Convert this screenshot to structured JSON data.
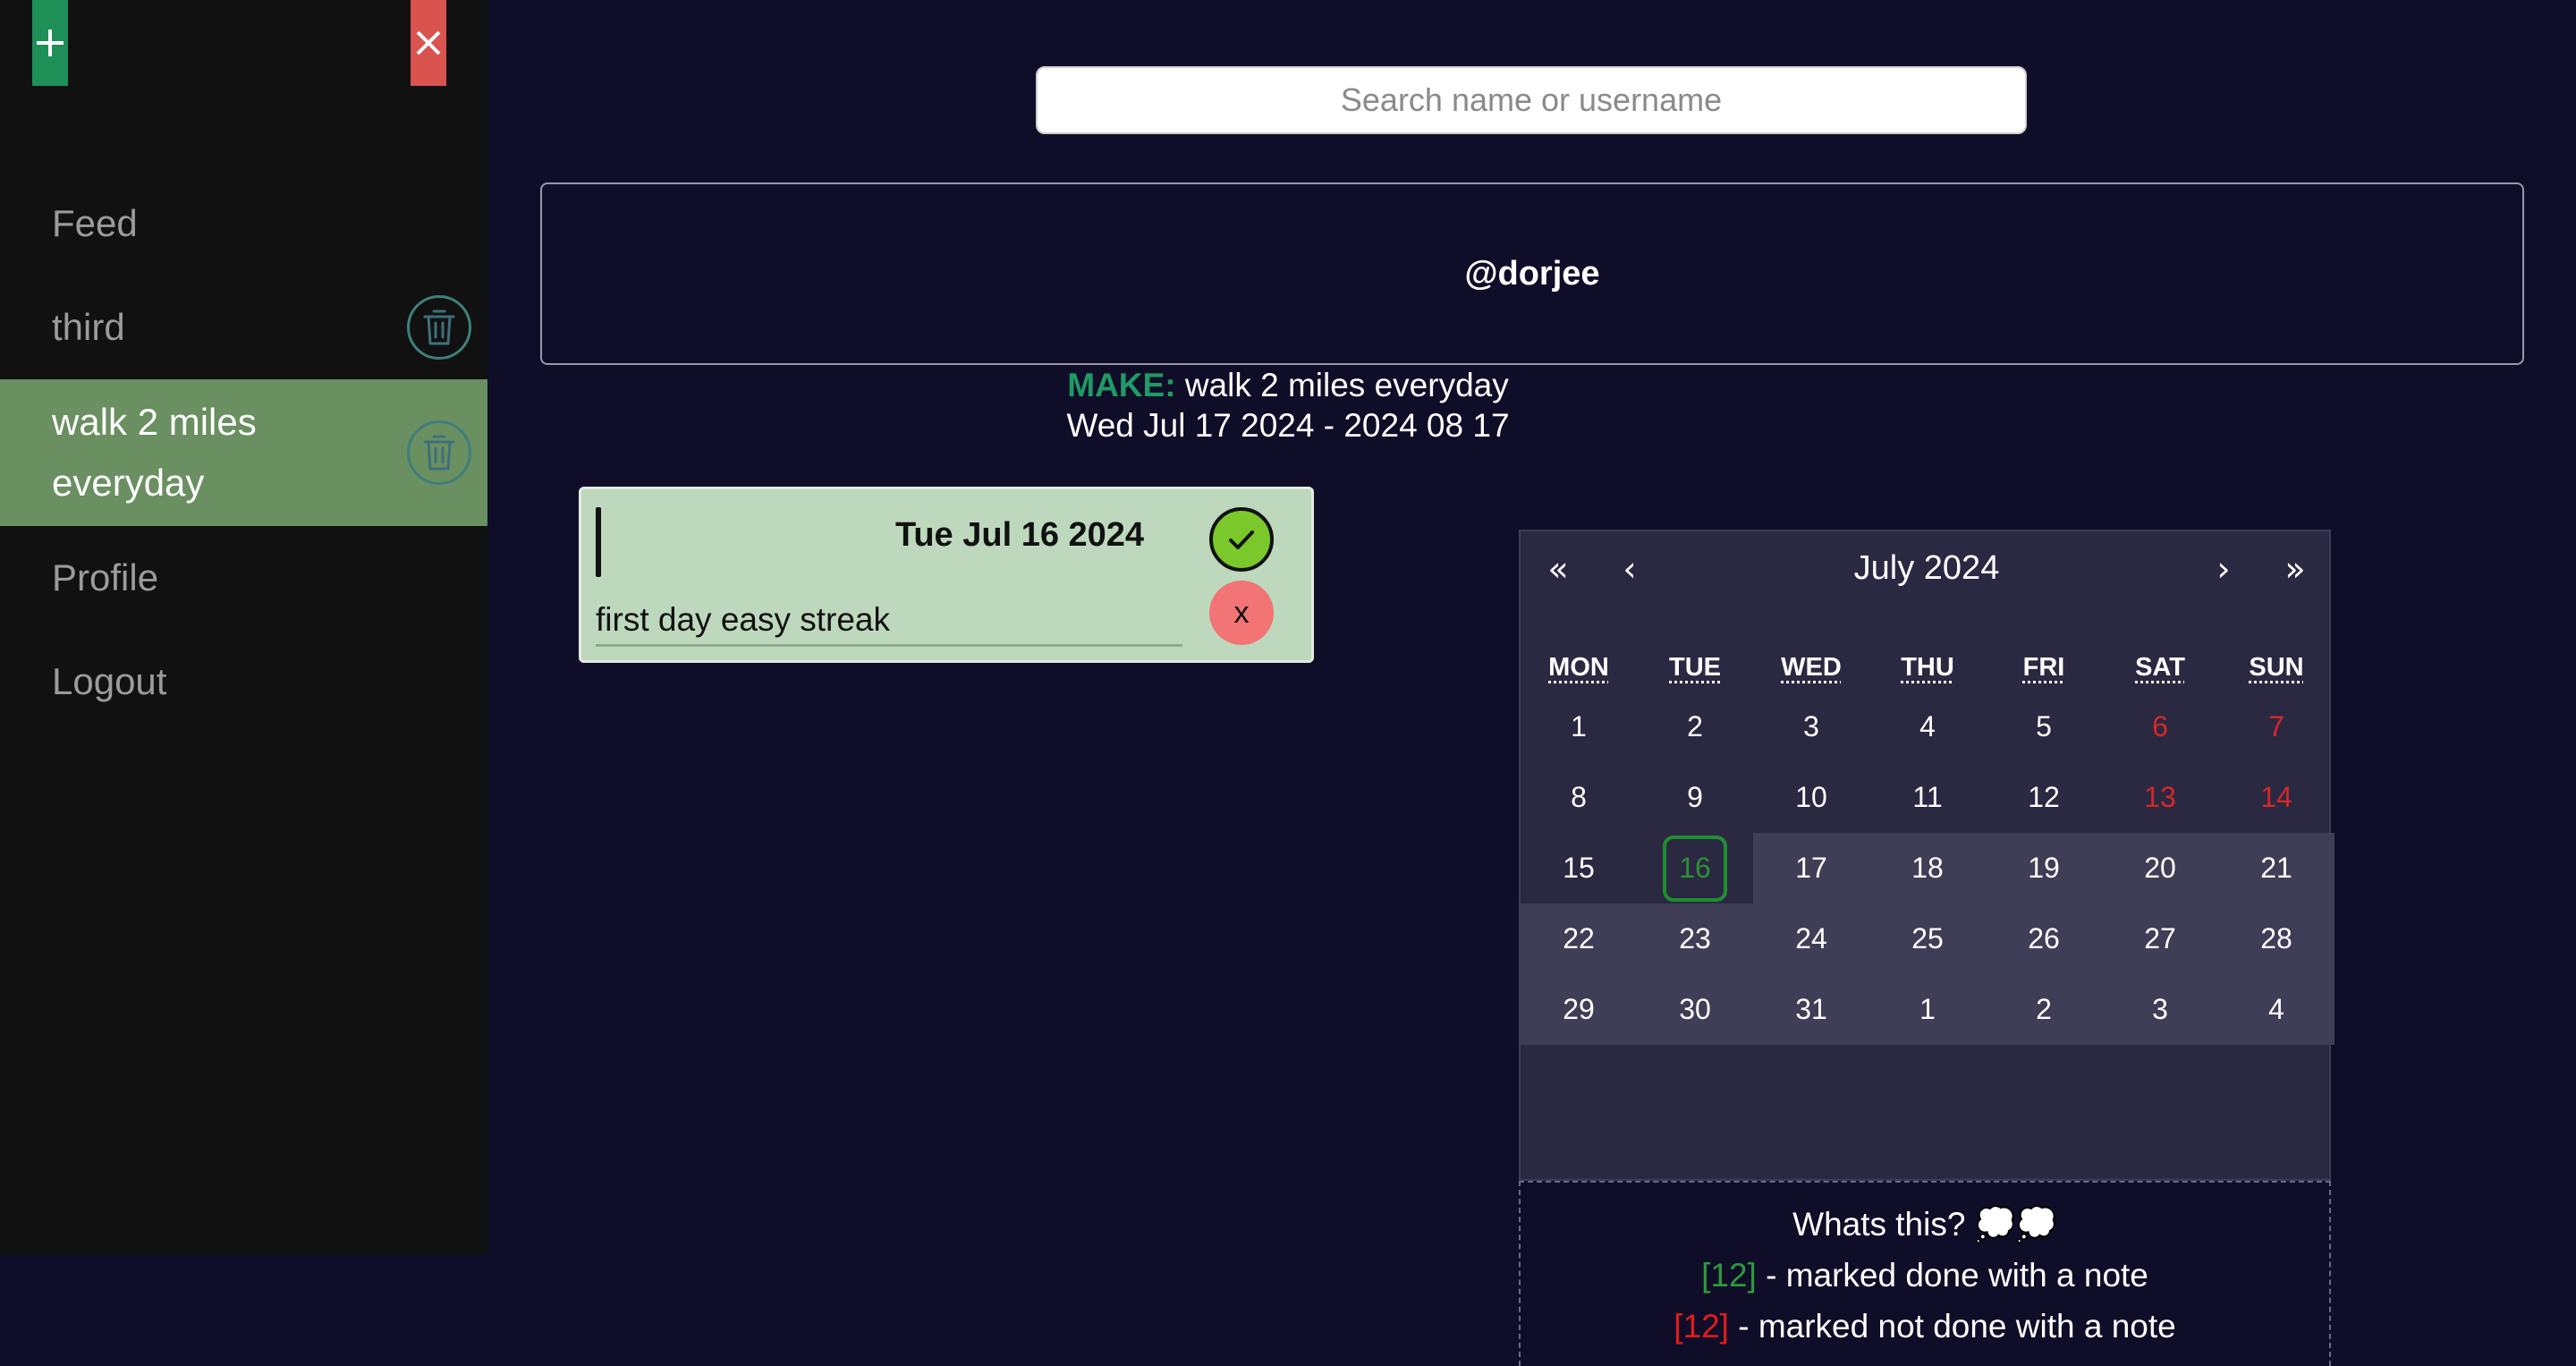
{
  "sidebar": {
    "add_label": "+",
    "close_label": "×",
    "items": [
      {
        "label": "Feed"
      },
      {
        "label": "third"
      },
      {
        "label": "walk 2 miles everyday"
      },
      {
        "label": "Profile"
      },
      {
        "label": "Logout"
      }
    ]
  },
  "search": {
    "placeholder": "Search name or username",
    "value": ""
  },
  "profile": {
    "username": "@dorjee"
  },
  "goal": {
    "prefix": "MAKE:",
    "text": "walk 2 miles everyday",
    "range": "Wed Jul 17 2024 - 2024 08 17"
  },
  "note": {
    "date": "Tue Jul 16 2024",
    "text": "first day easy streak",
    "cancel_label": "x"
  },
  "calendar": {
    "prev2": "«",
    "prev": "‹",
    "title": "July 2024",
    "next": "›",
    "next2": "»",
    "weekdays": [
      "MON",
      "TUE",
      "WED",
      "THU",
      "FRI",
      "SAT",
      "SUN"
    ],
    "weeks": [
      [
        "1",
        "2",
        "3",
        "4",
        "5",
        "6",
        "7"
      ],
      [
        "8",
        "9",
        "10",
        "11",
        "12",
        "13",
        "14"
      ],
      [
        "15",
        "16",
        "17",
        "18",
        "19",
        "20",
        "21"
      ],
      [
        "22",
        "23",
        "24",
        "25",
        "26",
        "27",
        "28"
      ],
      [
        "29",
        "30",
        "31",
        "1",
        "2",
        "3",
        "4"
      ]
    ]
  },
  "legend": {
    "title": "Whats this? 💭💭",
    "done_sample": "[12]",
    "done_text": " - marked done with a note",
    "not_done_sample": "[12]",
    "not_done_text": " - marked not done with a note"
  },
  "colors": {
    "background": "#100d29",
    "sidebar": "#111111",
    "active_item": "#6a8f61",
    "make_label": "#1f9a64",
    "note_card": "#bdd8bd",
    "check": "#7ac82a",
    "cancel": "#f27474",
    "weekend": "#d42828"
  }
}
